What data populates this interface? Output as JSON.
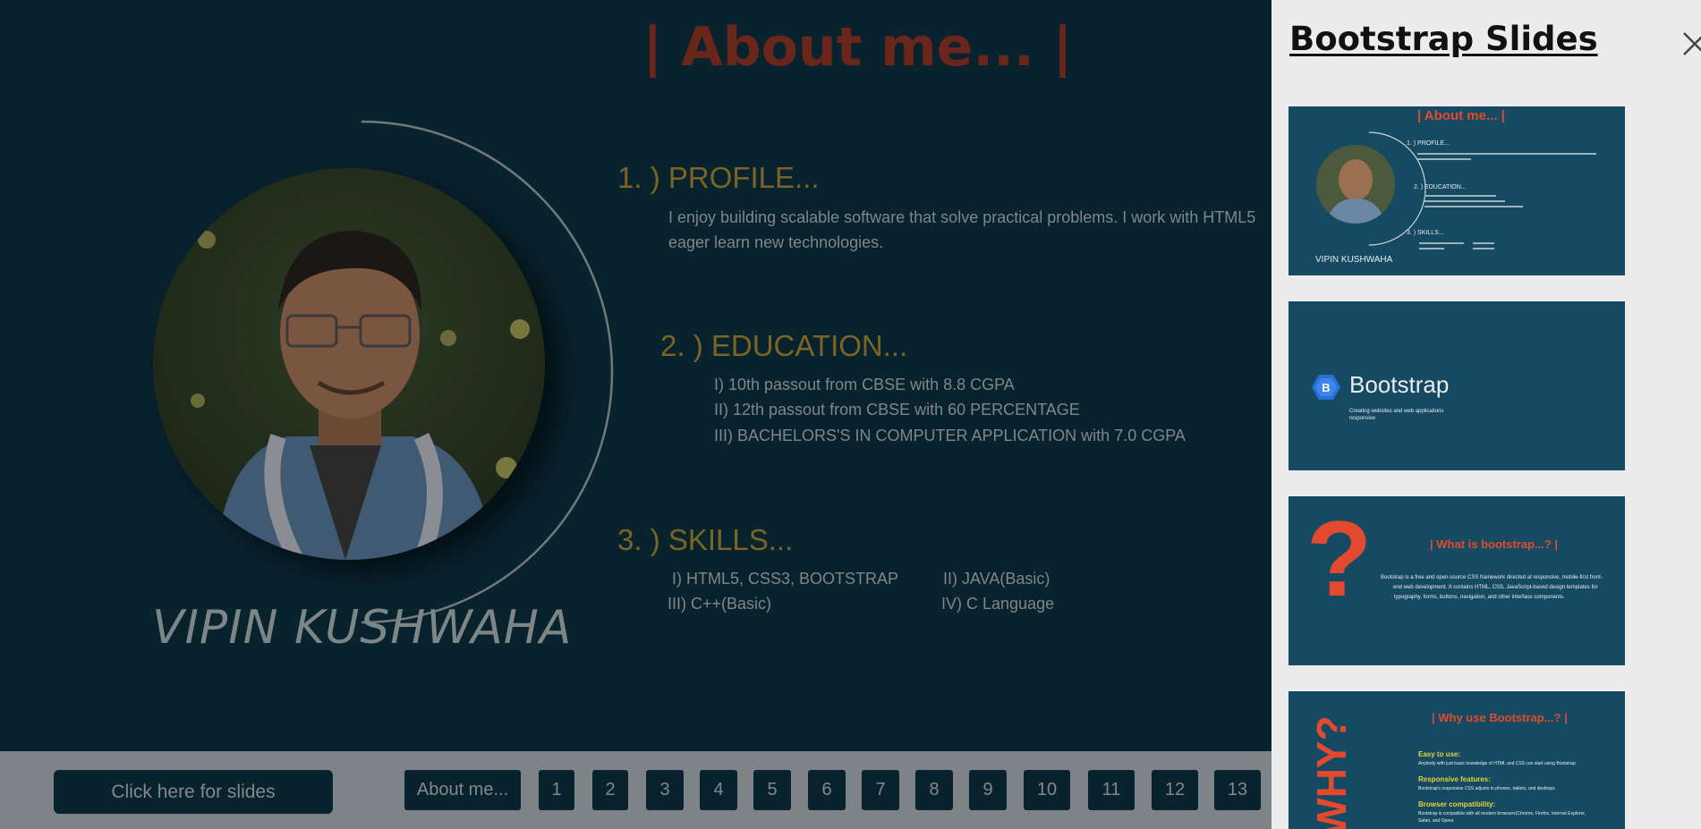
{
  "slide": {
    "title": "| About me... |",
    "person_name": "VIPIN KUSHWAHA",
    "profile": {
      "heading": "1. ) PROFILE...",
      "lines": [
        "I enjoy building scalable software that solve practical problems. I work with HTML5",
        "eager learn new technologies."
      ]
    },
    "education": {
      "heading": "2. ) EDUCATION...",
      "items": [
        "I) 10th passout from CBSE with 8.8 CGPA",
        "II) 12th passout from CBSE with 60 PERCENTAGE",
        "III) BACHELORS'S IN COMPUTER APPLICATION with 7.0 CGPA"
      ]
    },
    "skills": {
      "heading": "3. ) SKILLS...",
      "items": [
        "I) HTML5, CSS3, BOOTSTRAP",
        "II) JAVA(Basic)",
        "III) C++(Basic)",
        "IV) C Language"
      ]
    }
  },
  "navbar": {
    "slides_button": "Click here for slides",
    "about_button": "About me...",
    "pages": [
      "1",
      "2",
      "3",
      "4",
      "5",
      "6",
      "7",
      "8",
      "9",
      "10",
      "11",
      "12",
      "13"
    ]
  },
  "panel": {
    "title": "Bootstrap Slides",
    "close_icon": "close-icon",
    "thumb1": {
      "title": "| About me... |",
      "profile": "1. ) PROFILE...",
      "education": "2. ) EDUCATION...",
      "skills": "3. ) SKILLS...",
      "name": "VIPIN KUSHWAHA"
    },
    "thumb2": {
      "brand": "Bootstrap",
      "tagline_1": "Creating websites and web applications",
      "tagline_2": "responsive",
      "logo_icon": "bootstrap-logo-icon"
    },
    "thumb3": {
      "glyph": "?",
      "title": "| What is bootstrap...? |",
      "body_1": "Bootstrap is a free and open-source CSS framework directed at responsive, mobile-first front-",
      "body_2": "end web development. It contains HTML, CSS, JavaScript-based design templates for",
      "body_3": "typography, forms, buttons, navigation, and other interface components."
    },
    "thumb4": {
      "side_word": "WHY?",
      "title": "| Why use Bootstrap...? |",
      "h1": "Easy to use:",
      "p1": "Anybody with just basic knowledge of HTML and CSS can start using Bootstrap",
      "h2": "Responsive features:",
      "p2": "Bootstrap's responsive CSS adjusts to phones, tablets, and desktops",
      "h3": "Browser compatibility:",
      "p3": "Bootstrap is compatible with all modern browsers(Chrome, Firefox, Internet Explorer,",
      "p3b": "Safari, and Opera"
    }
  },
  "colors": {
    "slide_bg": "#08222e",
    "title_red": "#6a261b",
    "heading_gold": "#7a6624",
    "panel_bg": "#ececec",
    "thumb_bg": "#164a62",
    "nav_bar": "#7d8387"
  }
}
